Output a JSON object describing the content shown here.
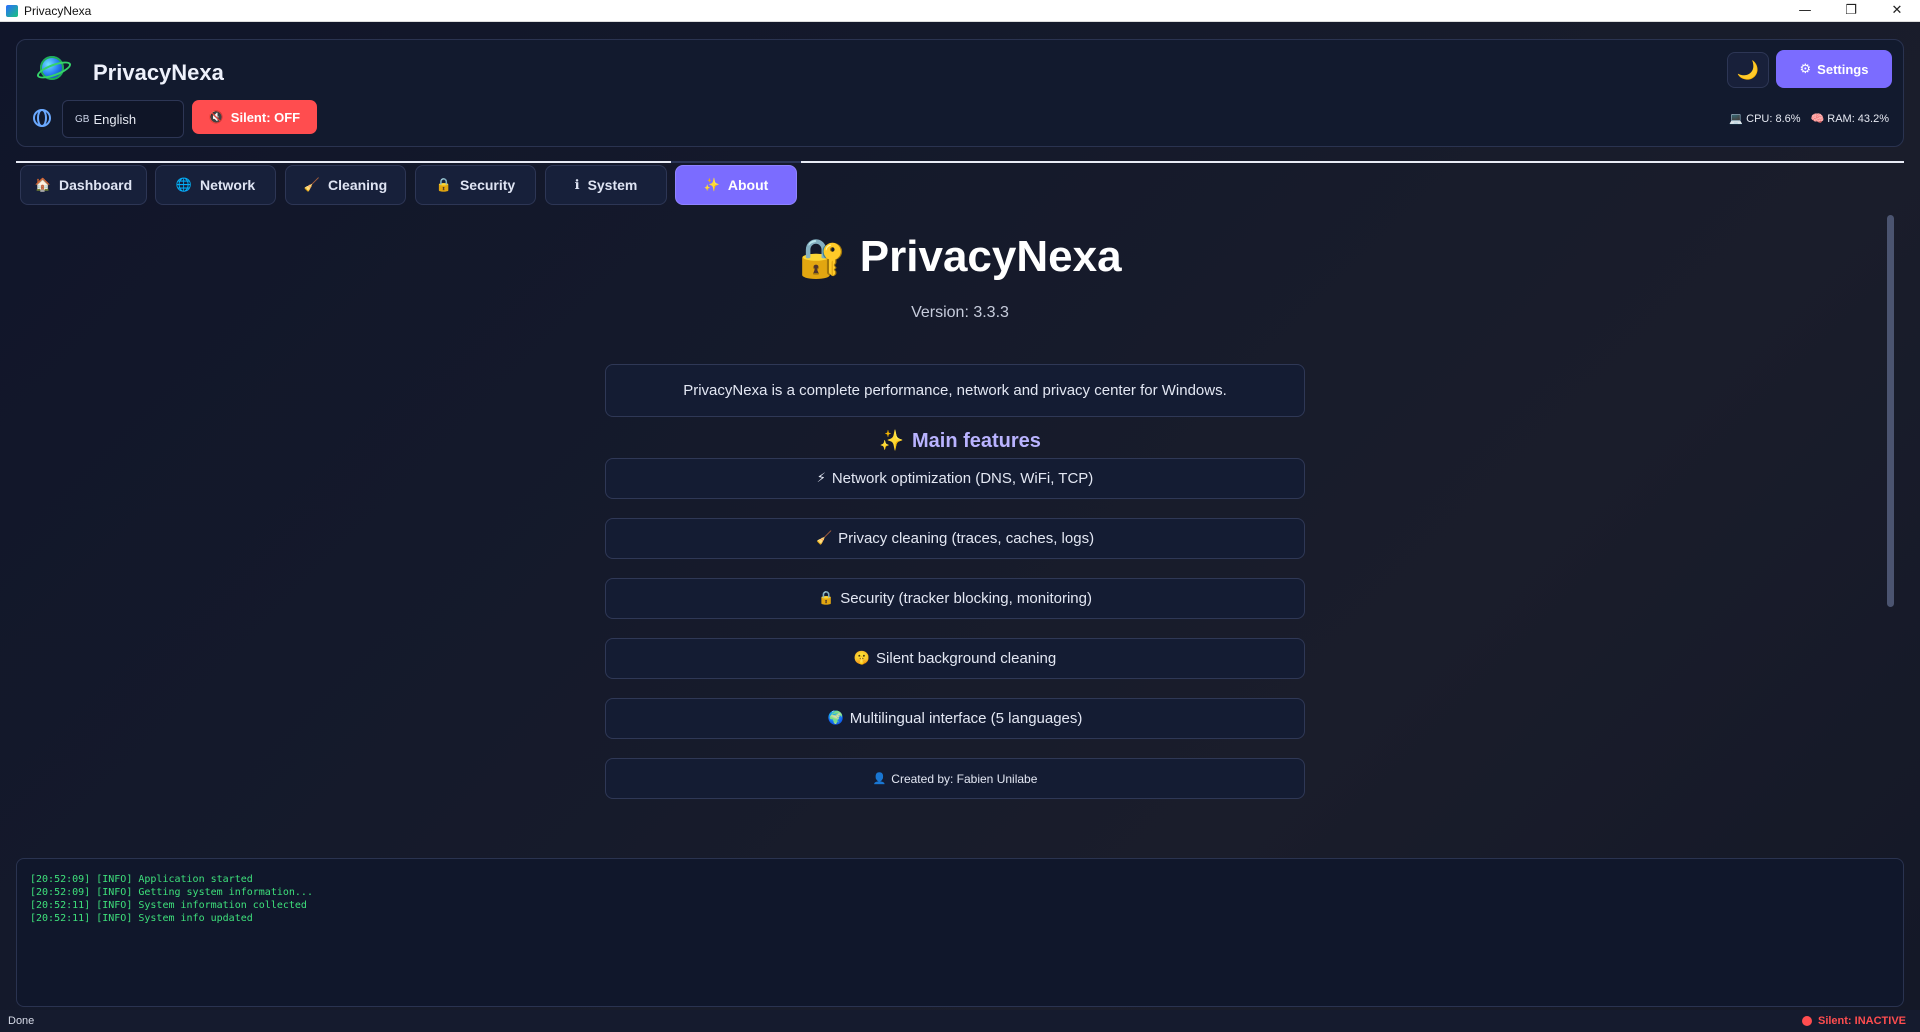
{
  "window": {
    "title": "PrivacyNexa",
    "minimize": "—",
    "maximize": "❐",
    "close": "✕"
  },
  "header": {
    "app_name": "PrivacyNexa",
    "language": {
      "flag": "GB",
      "value": "English"
    },
    "silent_button": {
      "icon": "🔇",
      "label": "Silent: OFF"
    },
    "theme_icon": "🌙",
    "settings": {
      "icon": "⚙",
      "label": "Settings"
    },
    "stats": {
      "cpu_icon": "💻",
      "cpu": "CPU: 8.6%",
      "ram_icon": "🧠",
      "ram": "RAM: 43.2%"
    }
  },
  "tabs": [
    {
      "icon": "🏠",
      "label": "Dashboard"
    },
    {
      "icon": "🌐",
      "label": "Network"
    },
    {
      "icon": "🧹",
      "label": "Cleaning"
    },
    {
      "icon": "🔒",
      "label": "Security"
    },
    {
      "icon": "ℹ",
      "label": "System"
    },
    {
      "icon": "✨",
      "label": "About"
    }
  ],
  "about": {
    "lock_icon": "🔐",
    "title": "PrivacyNexa",
    "version": "Version: 3.3.3",
    "description": "PrivacyNexa is a complete performance, network and privacy center for Windows.",
    "features_icon": "✨",
    "features_title": "Main features",
    "features": [
      {
        "icon": "⚡",
        "label": "Network optimization (DNS, WiFi, TCP)"
      },
      {
        "icon": "🧹",
        "label": "Privacy cleaning (traces, caches, logs)"
      },
      {
        "icon": "🔒",
        "label": "Security (tracker blocking, monitoring)"
      },
      {
        "icon": "🤫",
        "label": "Silent background cleaning"
      },
      {
        "icon": "🌍",
        "label": "Multilingual interface (5 languages)"
      }
    ],
    "credit": {
      "icon": "👤",
      "label": "Created by: Fabien Unilabe"
    }
  },
  "log": [
    "[20:52:09] [INFO] Application started",
    "[20:52:09] [INFO] Getting system information...",
    "[20:52:11] [INFO] System information collected",
    "[20:52:11] [INFO] System info updated"
  ],
  "statusbar": {
    "left": "Done",
    "right": "Silent: INACTIVE"
  },
  "colors": {
    "accent": "#7b6cff",
    "danger": "#ff4d4f",
    "log_text": "#3ee07b",
    "background": "#141a2c"
  }
}
